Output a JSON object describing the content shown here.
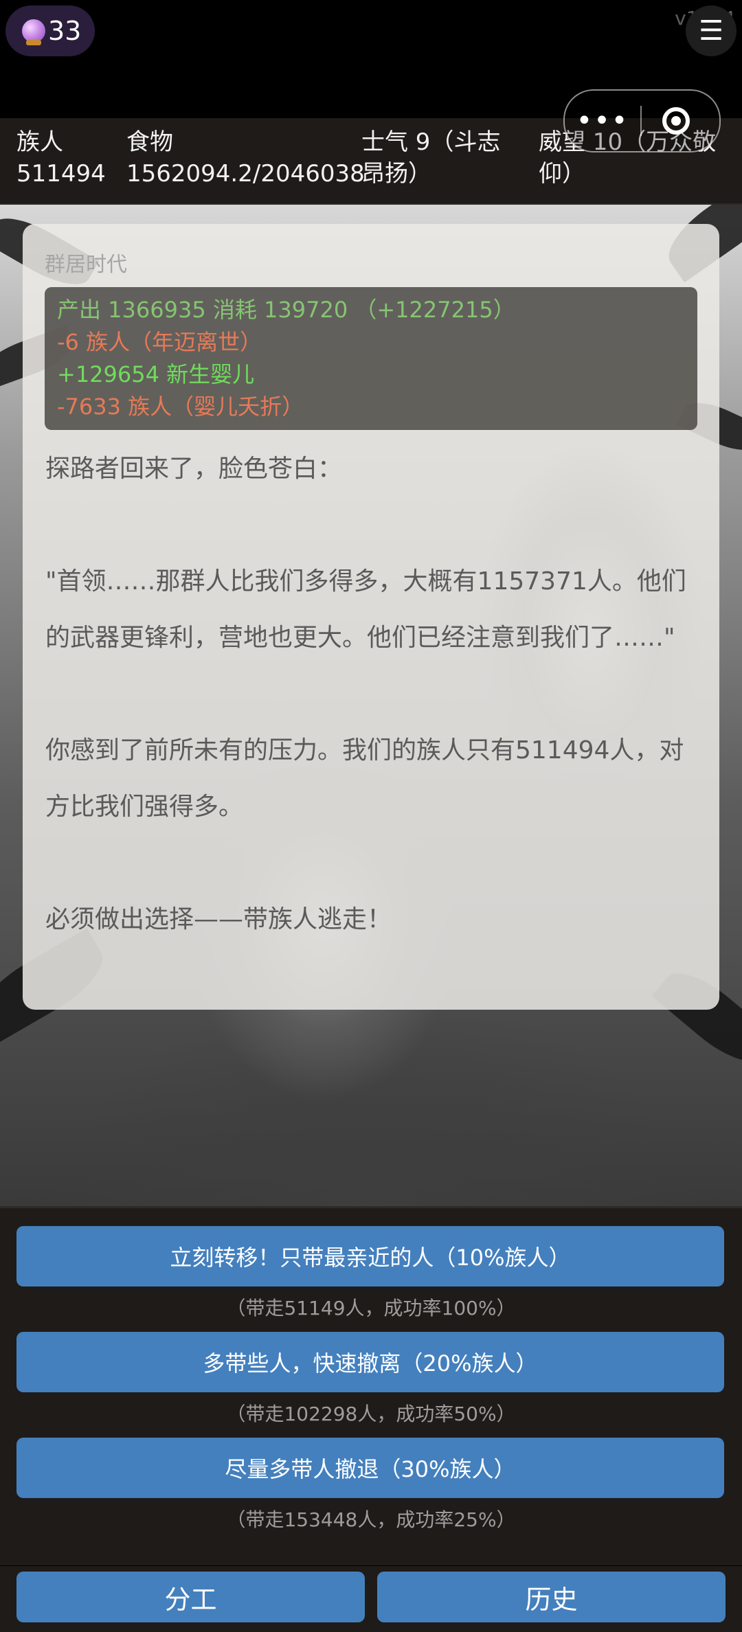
{
  "topbar": {
    "gem_count": "33",
    "version": "v1.1.4",
    "menu_glyph": "☰",
    "capsule_more": "•••"
  },
  "stats": {
    "population": {
      "label": "族人",
      "value": "511494"
    },
    "food": {
      "label": "食物",
      "value": "1562094.2/2046038"
    },
    "morale": {
      "text": "士气 9（斗志昂扬）"
    },
    "prestige": {
      "text": "威望 10（万众敬仰）"
    }
  },
  "card": {
    "era": "群居时代",
    "summary": [
      {
        "text": "产出 1366935  消耗 139720  （+1227215）",
        "tone": "green"
      },
      {
        "text": "-6 族人（年迈离世）",
        "tone": "red"
      },
      {
        "text": "+129654 新生婴儿",
        "tone": "bright"
      },
      {
        "text": "-7633 族人（婴儿夭折）",
        "tone": "red"
      }
    ],
    "story": [
      "探路者回来了，脸色苍白：",
      "\"首领……那群人比我们多得多，大概有1157371人。他们的武器更锋利，营地也更大。他们已经注意到我们了……\"",
      "你感到了前所未有的压力。我们的族人只有511494人，对方比我们强得多。",
      "必须做出选择——带族人逃走！"
    ]
  },
  "choices": [
    {
      "label": "立刻转移！只带最亲近的人（10%族人）",
      "note": "（带走51149人，成功率100%）"
    },
    {
      "label": "多带些人，快速撤离（20%族人）",
      "note": "（带走102298人，成功率50%）"
    },
    {
      "label": "尽量多带人撤退（30%族人）",
      "note": "（带走153448人，成功率25%）"
    }
  ],
  "footer": {
    "division_label": "分工",
    "history_label": "历史"
  },
  "colors": {
    "button_blue": "#4480be",
    "panel_bg": "#1f1b18",
    "positive_green": "#86c572",
    "negative_red": "#e67a57"
  }
}
